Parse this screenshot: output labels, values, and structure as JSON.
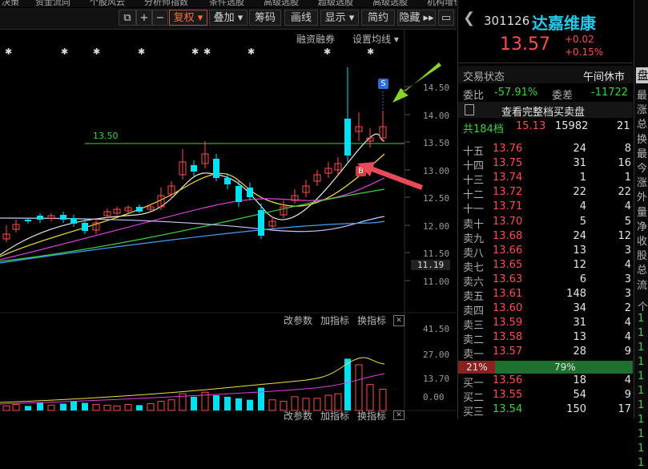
{
  "top_menu": [
    "决策",
    "资金流向",
    "个股风云",
    "分析师指数",
    "条件选股",
    "高级选股",
    "超级选股",
    "高级选股",
    "机构增仓",
    "热点组合",
    "高低长期",
    "机构推荐",
    "高管买"
  ],
  "toolbar": {
    "window_btn": "⧉",
    "plus_btn": "+",
    "minus_btn": "−",
    "fuquan": "复权 ▾",
    "diejia": "叠加 ▾",
    "chouma": "筹码",
    "huaxian": "画线",
    "xianshi": "显示 ▾",
    "jianyue": "简约",
    "yincang": "隐藏 ▸▸",
    "expand": "▭"
  },
  "chart_links": {
    "margin": "融资融券",
    "ma_setting": "设置均线 ▾"
  },
  "price_axis": [
    "14.50",
    "14.00",
    "13.50",
    "13.00",
    "12.50",
    "12.00",
    "11.50",
    "11.19",
    "11.00"
  ],
  "hline_label": "13.50",
  "markers": {
    "s": "S",
    "b": "B"
  },
  "indicator_links": {
    "params": "改参数",
    "add": "加指标",
    "change": "换指标",
    "close": "✕"
  },
  "vol_axis": [
    "41.50",
    "27.00",
    "13.70",
    "0.00"
  ],
  "bottom_links": {
    "params": "改参数",
    "add": "加指标",
    "change": "换指标",
    "close": "✕"
  },
  "stock": {
    "code": "301126",
    "name": "达嘉维康",
    "price": "13.57",
    "change": "+0.02",
    "pct": "+0.15%"
  },
  "status": {
    "label": "交易状态",
    "value": "午间休市"
  },
  "ratio": {
    "label": "委比",
    "value": "-57.91%",
    "diff_label": "委差",
    "diff_value": "-11722"
  },
  "full_book": "查看完整档买卖盘",
  "total": {
    "label": "共184档",
    "price": "15.13",
    "vol": "15982",
    "count": "21"
  },
  "asks": [
    {
      "label": "十五",
      "price": "13.76",
      "vol": "24",
      "n": "8"
    },
    {
      "label": "十四",
      "price": "13.75",
      "vol": "31",
      "n": "16"
    },
    {
      "label": "十三",
      "price": "13.74",
      "vol": "1",
      "n": "1"
    },
    {
      "label": "十二",
      "price": "13.72",
      "vol": "22",
      "n": "22"
    },
    {
      "label": "十一",
      "price": "13.71",
      "vol": "4",
      "n": "4"
    },
    {
      "label": "卖十",
      "price": "13.70",
      "vol": "5",
      "n": "5"
    },
    {
      "label": "卖九",
      "price": "13.68",
      "vol": "24",
      "n": "12"
    },
    {
      "label": "卖八",
      "price": "13.66",
      "vol": "13",
      "n": "3"
    },
    {
      "label": "卖七",
      "price": "13.65",
      "vol": "12",
      "n": "4"
    },
    {
      "label": "卖六",
      "price": "13.63",
      "vol": "6",
      "n": "3"
    },
    {
      "label": "卖五",
      "price": "13.61",
      "vol": "148",
      "n": "3"
    },
    {
      "label": "卖四",
      "price": "13.60",
      "vol": "34",
      "n": "2"
    },
    {
      "label": "卖三",
      "price": "13.59",
      "vol": "31",
      "n": "4"
    },
    {
      "label": "卖二",
      "price": "13.58",
      "vol": "13",
      "n": "4"
    },
    {
      "label": "卖一",
      "price": "13.57",
      "vol": "28",
      "n": "9"
    }
  ],
  "bar_split": {
    "left": "21%",
    "right": "79%",
    "left_pct": 21
  },
  "bids": [
    {
      "label": "买一",
      "price": "13.56",
      "vol": "18",
      "n": "4"
    },
    {
      "label": "买二",
      "price": "13.55",
      "vol": "54",
      "n": "9"
    },
    {
      "label": "买三",
      "price": "13.54",
      "vol": "150",
      "n": "17"
    }
  ],
  "side_tab": "盘",
  "side_chars": [
    "最",
    "涨",
    "总",
    "换",
    "最",
    "今",
    "涨",
    "外",
    "量",
    "净",
    "收",
    "股",
    "总",
    "流"
  ],
  "side_green_chars": [
    "个",
    "1",
    "1",
    "1",
    "1",
    "1",
    "1",
    "1",
    "1",
    "1",
    "1",
    "1"
  ],
  "colors": {
    "up": "#ff4d4d",
    "down": "#00e0f0",
    "ma5": "#e8e8e8",
    "ma10": "#f0e040",
    "ma20": "#e040e0",
    "ma30": "#40d040",
    "ma60": "#c8c8ff",
    "ma120": "#40a0ff"
  }
}
